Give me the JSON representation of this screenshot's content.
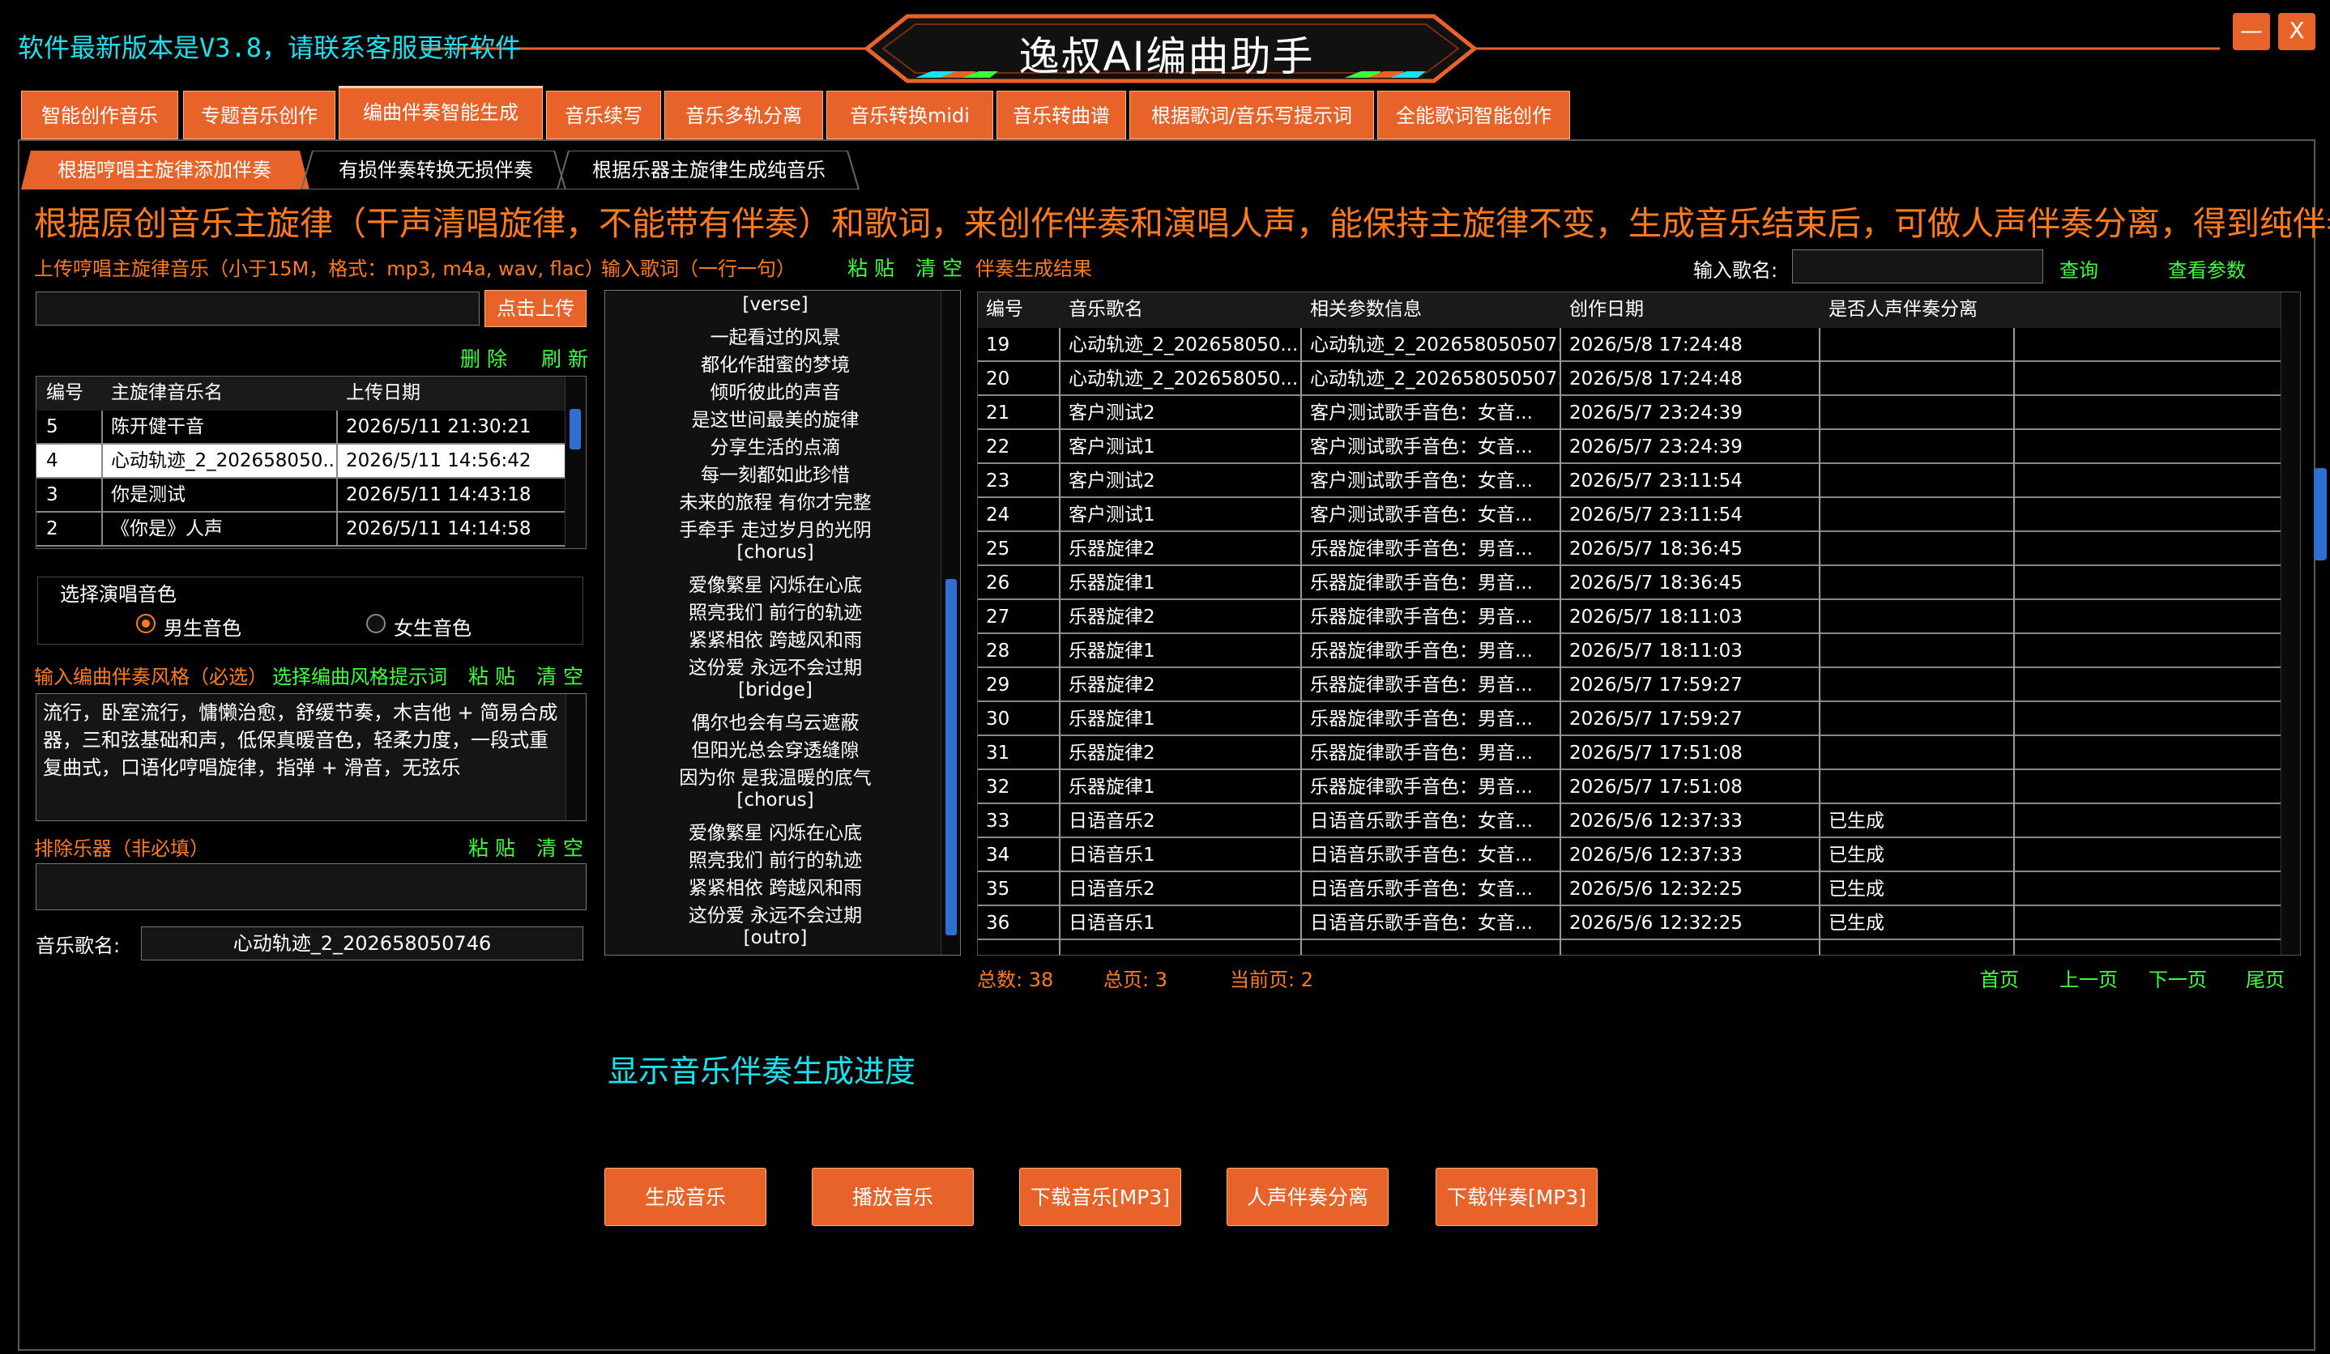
{
  "header": {
    "update_notice": "软件最新版本是V3.8，请联系客服更新软件",
    "app_title": "逸叔AI编曲助手",
    "minimize_label": "—",
    "close_label": "X"
  },
  "main_tabs": [
    {
      "label": "智能创作音乐"
    },
    {
      "label": "专题音乐创作"
    },
    {
      "label": "编曲伴奏智能生成",
      "active": true
    },
    {
      "label": "音乐续写"
    },
    {
      "label": "音乐多轨分离"
    },
    {
      "label": "音乐转换midi"
    },
    {
      "label": "音乐转曲谱"
    },
    {
      "label": "根据歌词/音乐写提示词"
    },
    {
      "label": "全能歌词智能创作"
    }
  ],
  "sub_tabs": [
    {
      "label": "根据哼唱主旋律添加伴奏",
      "active": true
    },
    {
      "label": "有损伴奏转换无损伴奏"
    },
    {
      "label": "根据乐器主旋律生成纯音乐"
    }
  ],
  "headline": "根据原创音乐主旋律（干声清唱旋律，不能带有伴奏）和歌词，来创作伴奏和演唱人声，能保持主旋律不变，生成音乐结束后，可做人声伴奏分离，得到纯伴奏。",
  "upload": {
    "label": "上传哼唱主旋律音乐（小于15M，格式：mp3, m4a, wav, flac）",
    "path_value": "",
    "button": "点击上传",
    "delete": "删 除",
    "refresh": "刷 新"
  },
  "melody_table": {
    "headers": [
      "编号",
      "主旋律音乐名",
      "上传日期"
    ],
    "rows": [
      [
        "5",
        "陈开健干音",
        "2026/5/11 21:30:21"
      ],
      [
        "4",
        "心动轨迹_2_202658050...",
        "2026/5/11 14:56:42"
      ],
      [
        "3",
        "你是测试",
        "2026/5/11 14:43:18"
      ],
      [
        "2",
        "《你是》人声",
        "2026/5/11 14:14:58"
      ]
    ],
    "selected_row": 1
  },
  "voice": {
    "group_label": "选择演唱音色",
    "male": "男生音色",
    "female": "女生音色",
    "selected": "male"
  },
  "style": {
    "label": "输入编曲伴奏风格（必选）",
    "hint_link": "选择编曲风格提示词",
    "paste": "粘 贴",
    "clear": "清 空",
    "value": "流行，卧室流行，慵懒治愈，舒缓节奏，木吉他 + 简易合成器，三和弦基础和声，低保真暖音色，轻柔力度，一段式重复曲式，口语化哼唱旋律，指弹 + 滑音，无弦乐"
  },
  "exclude": {
    "label": "排除乐器（非必填）",
    "paste": "粘 贴",
    "clear": "清 空",
    "value": ""
  },
  "song_name": {
    "label": "音乐歌名:",
    "value": "心动轨迹_2_202658050746"
  },
  "lyrics": {
    "label": "输入歌词（一行一句）",
    "paste": "粘 贴",
    "clear": "清 空",
    "result_label": "伴奏生成结果",
    "lines": [
      "[verse]",
      "一起看过的风景",
      "都化作甜蜜的梦境",
      "倾听彼此的声音",
      "是这世间最美的旋律",
      "分享生活的点滴",
      "每一刻都如此珍惜",
      "未来的旅程 有你才完整",
      "手牵手 走过岁月的光阴",
      "[chorus]",
      "爱像繁星 闪烁在心底",
      "照亮我们 前行的轨迹",
      "紧紧相依 跨越风和雨",
      "这份爱 永远不会过期",
      "[bridge]",
      "偶尔也会有乌云遮蔽",
      "但阳光总会穿透缝隙",
      "因为你 是我温暖的底气",
      "[chorus]",
      "爱像繁星 闪烁在心底",
      "照亮我们 前行的轨迹",
      "紧紧相依 跨越风和雨",
      "这份爱 永远不会过期",
      "[outro]"
    ]
  },
  "search": {
    "label": "输入歌名:",
    "value": "",
    "query": "查询",
    "view_params": "查看参数"
  },
  "result_table": {
    "headers": [
      "编号",
      "音乐歌名",
      "相关参数信息",
      "创作日期",
      "是否人声伴奏分离",
      ""
    ],
    "rows": [
      [
        "19",
        "心动轨迹_2_202658050...",
        "心动轨迹_2_202658050507...",
        "2026/5/8 17:24:48",
        "",
        ""
      ],
      [
        "20",
        "心动轨迹_2_202658050...",
        "心动轨迹_2_202658050507...",
        "2026/5/8 17:24:48",
        "",
        ""
      ],
      [
        "21",
        "客户测试2",
        "客户测试歌手音色：女音...",
        "2026/5/7 23:24:39",
        "",
        ""
      ],
      [
        "22",
        "客户测试1",
        "客户测试歌手音色：女音...",
        "2026/5/7 23:24:39",
        "",
        ""
      ],
      [
        "23",
        "客户测试2",
        "客户测试歌手音色：女音...",
        "2026/5/7 23:11:54",
        "",
        ""
      ],
      [
        "24",
        "客户测试1",
        "客户测试歌手音色：女音...",
        "2026/5/7 23:11:54",
        "",
        ""
      ],
      [
        "25",
        "乐器旋律2",
        "乐器旋律歌手音色：男音...",
        "2026/5/7 18:36:45",
        "",
        ""
      ],
      [
        "26",
        "乐器旋律1",
        "乐器旋律歌手音色：男音...",
        "2026/5/7 18:36:45",
        "",
        ""
      ],
      [
        "27",
        "乐器旋律2",
        "乐器旋律歌手音色：男音...",
        "2026/5/7 18:11:03",
        "",
        ""
      ],
      [
        "28",
        "乐器旋律1",
        "乐器旋律歌手音色：男音...",
        "2026/5/7 18:11:03",
        "",
        ""
      ],
      [
        "29",
        "乐器旋律2",
        "乐器旋律歌手音色：男音...",
        "2026/5/7 17:59:27",
        "",
        ""
      ],
      [
        "30",
        "乐器旋律1",
        "乐器旋律歌手音色：男音...",
        "2026/5/7 17:59:27",
        "",
        ""
      ],
      [
        "31",
        "乐器旋律2",
        "乐器旋律歌手音色：男音...",
        "2026/5/7 17:51:08",
        "",
        ""
      ],
      [
        "32",
        "乐器旋律1",
        "乐器旋律歌手音色：男音...",
        "2026/5/7 17:51:08",
        "",
        ""
      ],
      [
        "33",
        "日语音乐2",
        "日语音乐歌手音色：女音...",
        "2026/5/6 12:37:33",
        "已生成",
        ""
      ],
      [
        "34",
        "日语音乐1",
        "日语音乐歌手音色：女音...",
        "2026/5/6 12:37:33",
        "已生成",
        ""
      ],
      [
        "35",
        "日语音乐2",
        "日语音乐歌手音色：女音...",
        "2026/5/6 12:32:25",
        "已生成",
        ""
      ],
      [
        "36",
        "日语音乐1",
        "日语音乐歌手音色：女音...",
        "2026/5/6 12:32:25",
        "已生成",
        ""
      ]
    ]
  },
  "pagination": {
    "total": "总数: 38",
    "pages": "总页: 3",
    "current": "当前页: 2",
    "first": "首页",
    "prev": "上一页",
    "next": "下一页",
    "last": "尾页"
  },
  "progress_text": "显示音乐伴奏生成进度",
  "actions": {
    "generate": "生成音乐",
    "play": "播放音乐",
    "download_music": "下载音乐[MP3]",
    "separate": "人声伴奏分离",
    "download_accomp": "下载伴奏[MP3]"
  },
  "colors": {
    "accent": "#e8632a",
    "headline": "#ff7a1a",
    "link_green": "#3cff3c",
    "cyan": "#17e3f0",
    "background": "#000000"
  }
}
